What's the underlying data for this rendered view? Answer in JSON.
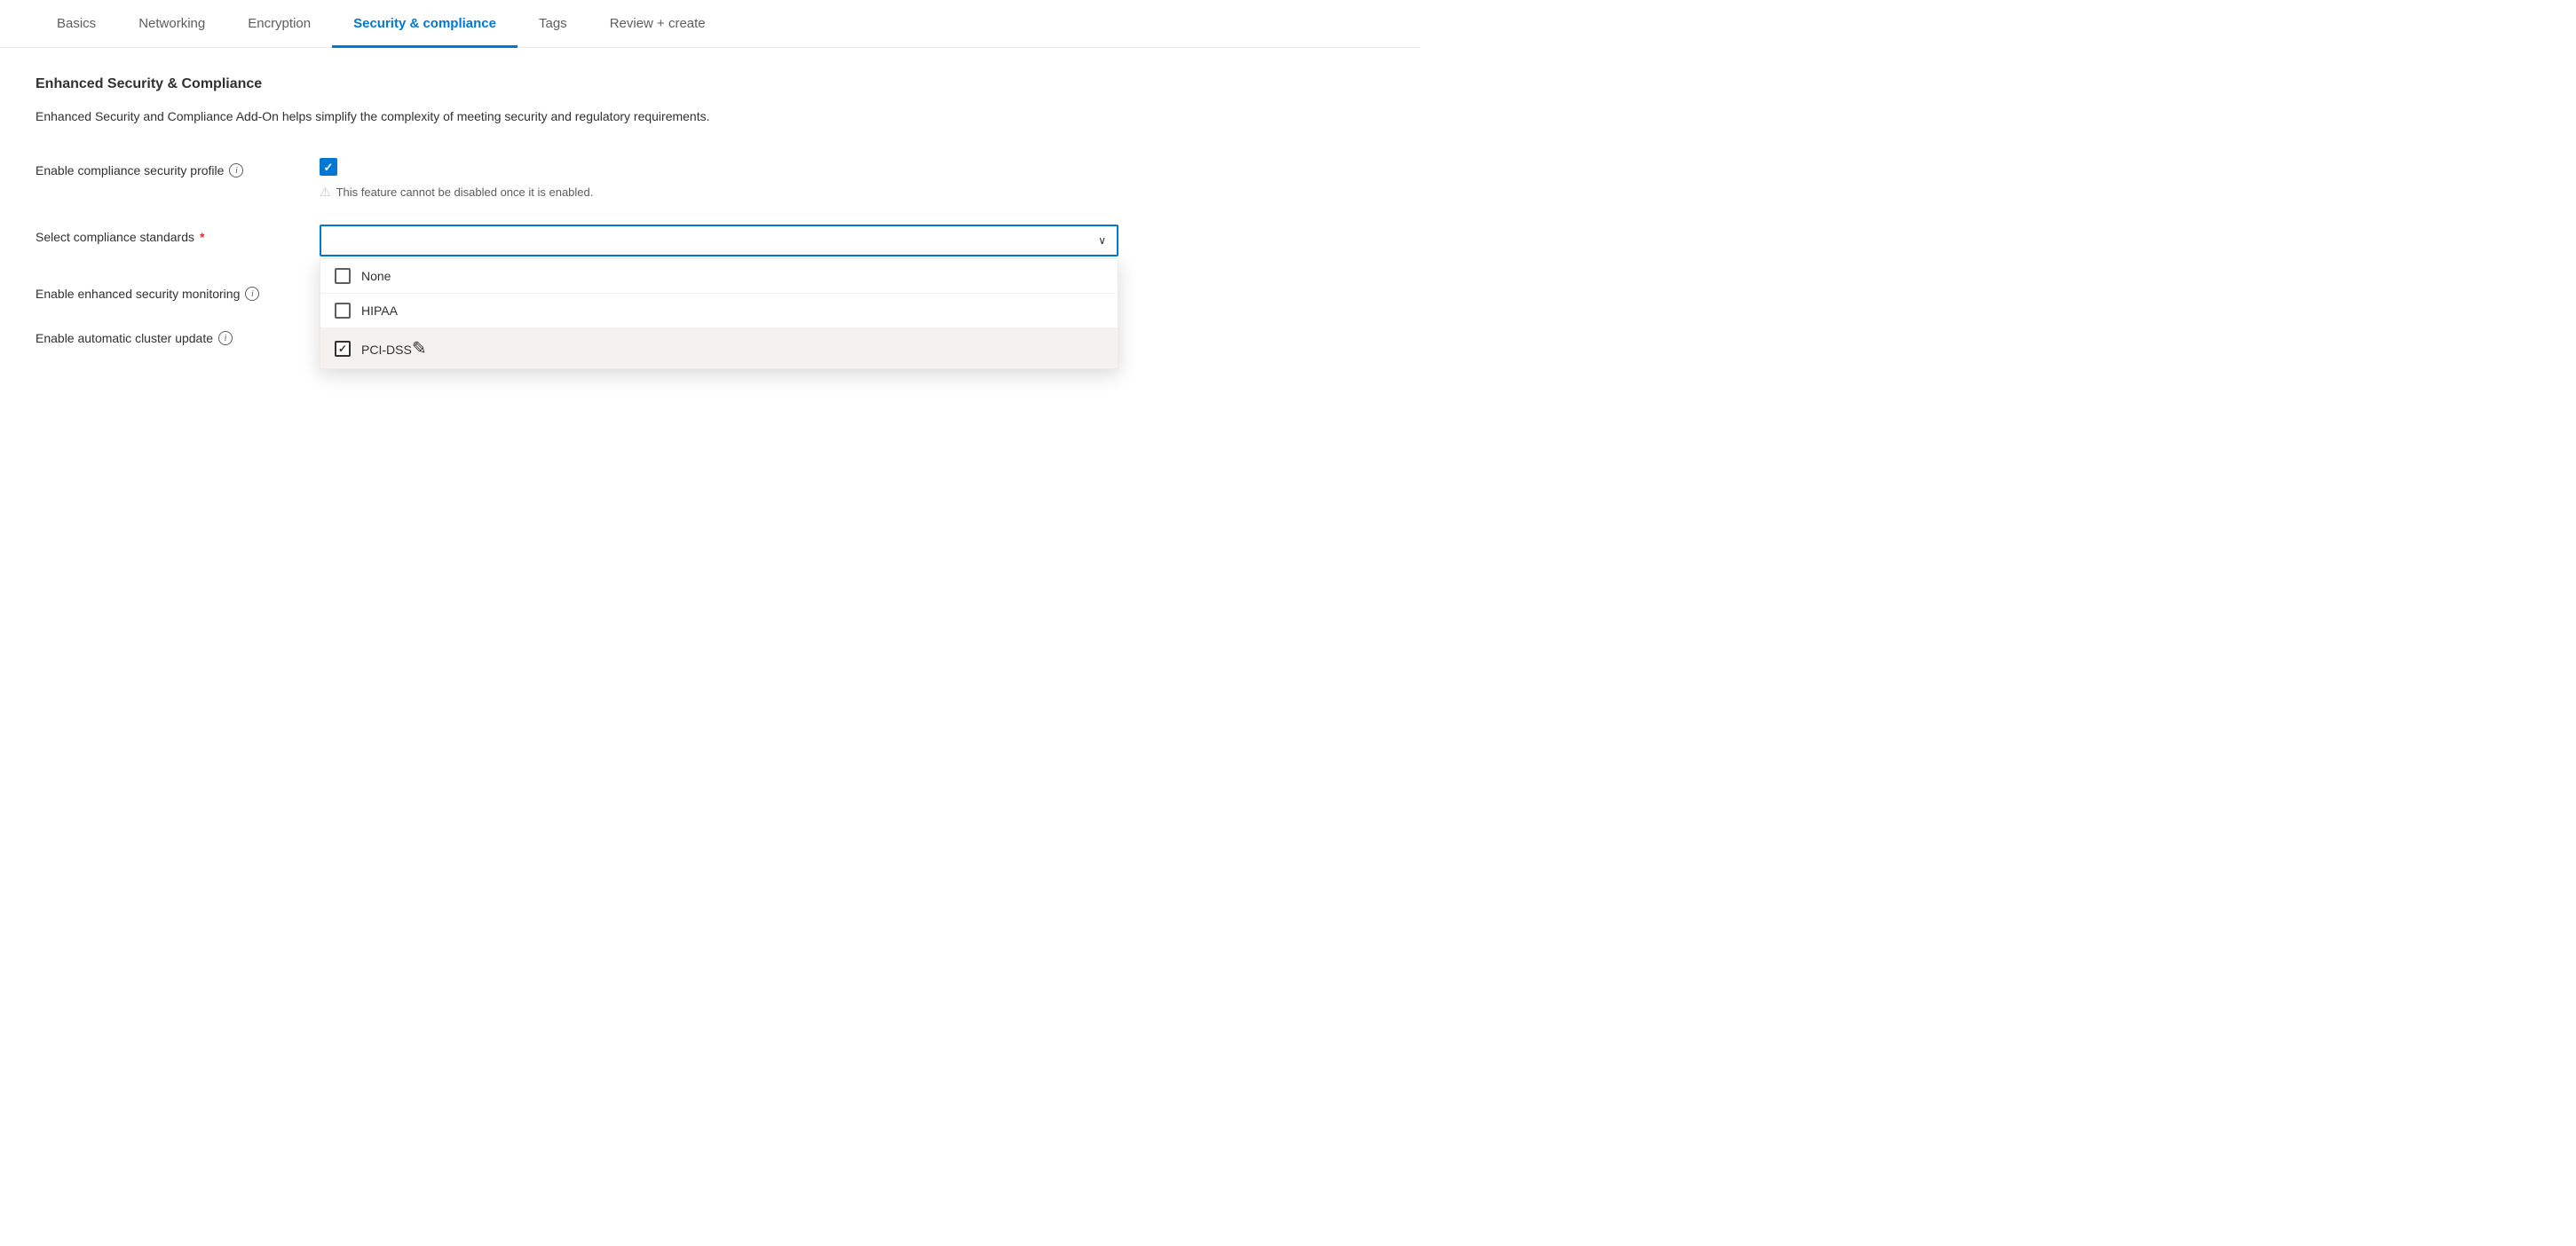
{
  "tabs": [
    {
      "id": "basics",
      "label": "Basics",
      "active": false
    },
    {
      "id": "networking",
      "label": "Networking",
      "active": false
    },
    {
      "id": "encryption",
      "label": "Encryption",
      "active": false
    },
    {
      "id": "security-compliance",
      "label": "Security & compliance",
      "active": true
    },
    {
      "id": "tags",
      "label": "Tags",
      "active": false
    },
    {
      "id": "review-create",
      "label": "Review + create",
      "active": false
    }
  ],
  "main": {
    "section_title": "Enhanced Security & Compliance",
    "section_description": "Enhanced Security and Compliance Add-On helps simplify the complexity of meeting security and regulatory requirements.",
    "form": {
      "compliance_profile": {
        "label": "Enable compliance security profile",
        "checked": true,
        "warning": "This feature cannot be disabled once it is enabled."
      },
      "compliance_standards": {
        "label": "Select compliance standards",
        "required": true,
        "placeholder": "",
        "options": [
          {
            "id": "none",
            "label": "None",
            "checked": false
          },
          {
            "id": "hipaa",
            "label": "HIPAA",
            "checked": false
          },
          {
            "id": "pci-dss",
            "label": "PCI-DSS",
            "checked": true
          }
        ]
      },
      "security_monitoring": {
        "label": "Enable enhanced security monitoring",
        "checked": true,
        "disabled": true
      },
      "cluster_update": {
        "label": "Enable automatic cluster update",
        "checked": true,
        "disabled": true
      }
    }
  },
  "icons": {
    "info": "i",
    "checkmark": "✓",
    "chevron_down": "∨",
    "warning": "⚠"
  }
}
